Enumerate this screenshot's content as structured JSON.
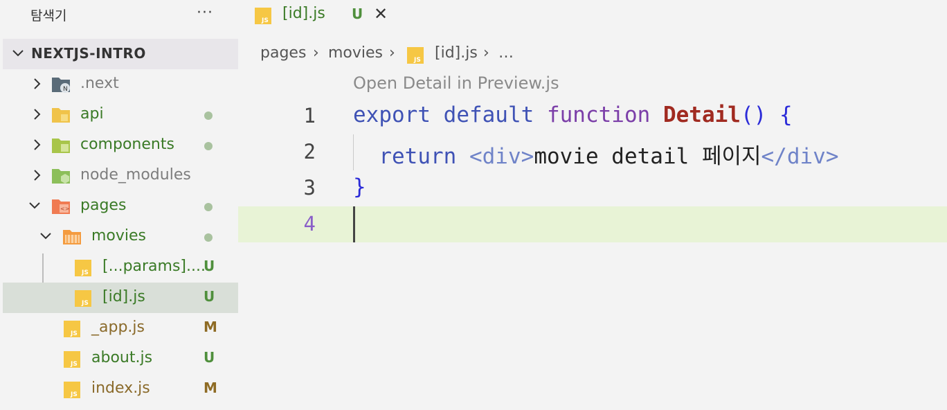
{
  "sidebar": {
    "title": "탐색기",
    "more": "···",
    "section": "NEXTJS-INTRO",
    "items": [
      {
        "label": ".next",
        "badge": ""
      },
      {
        "label": "api",
        "badge": "●"
      },
      {
        "label": "components",
        "badge": "●"
      },
      {
        "label": "node_modules",
        "badge": ""
      },
      {
        "label": "pages",
        "badge": "●"
      },
      {
        "label": "movies",
        "badge": "●"
      },
      {
        "label": "[...params]....",
        "badge": "U"
      },
      {
        "label": "[id].js",
        "badge": "U"
      },
      {
        "label": "_app.js",
        "badge": "M"
      },
      {
        "label": "about.js",
        "badge": "U"
      },
      {
        "label": "index.js",
        "badge": "M"
      }
    ]
  },
  "editor": {
    "tab": {
      "label": "[id].js",
      "badge": "U",
      "close": "✕"
    },
    "breadcrumb": {
      "p1": "pages",
      "p2": "movies",
      "p3": "[id].js",
      "p4": "…",
      "sep": "›"
    },
    "codelens": "Open Detail in Preview.js",
    "lines": [
      {
        "num": "1"
      },
      {
        "num": "2"
      },
      {
        "num": "3"
      },
      {
        "num": "4"
      }
    ],
    "code": {
      "l1_export": "export",
      "l1_default": "default",
      "l1_function": "function",
      "l1_name": "Detail",
      "l1_parens": "()",
      "l1_brace": "{",
      "l2_return": "return",
      "l2_open": "<div>",
      "l2_text": "movie detail 페이지",
      "l2_close": "</div>",
      "l3_brace": "}"
    }
  },
  "colors": {
    "folder_next": "#5a6b78",
    "folder_api": "#f0c34a",
    "folder_components": "#a8c54a",
    "folder_node": "#8cbf5a",
    "folder_pages": "#f07b52",
    "folder_movies": "#f49b3f",
    "js_icon": "#f6c744"
  }
}
